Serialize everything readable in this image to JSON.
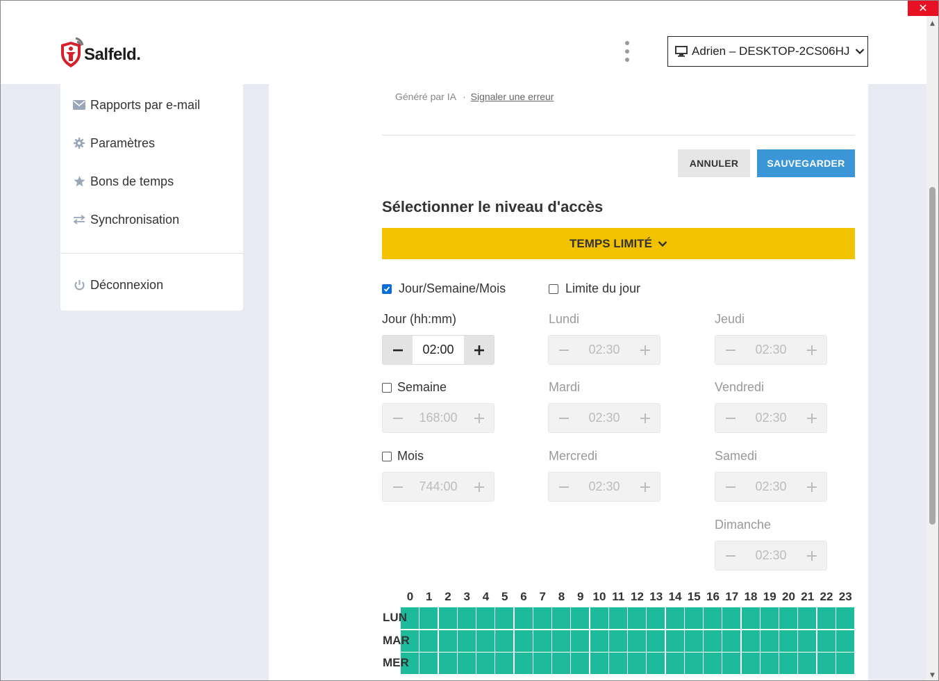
{
  "window": {
    "close_symbol": "✕"
  },
  "header": {
    "logo_text": "Salfeld.",
    "device_label": "Adrien – DESKTOP-2CS06HJ"
  },
  "sidebar": {
    "items": [
      {
        "label": "Rapports par e-mail",
        "icon": "envelope-icon"
      },
      {
        "label": "Paramètres",
        "icon": "gear-icon"
      },
      {
        "label": "Bons de temps",
        "icon": "star-icon"
      },
      {
        "label": "Synchronisation",
        "icon": "sync-arrows-icon"
      }
    ],
    "logout_label": "Déconnexion"
  },
  "ai_note": {
    "generated": "Généré par IA",
    "separator": "·",
    "report_link": "Signaler une erreur"
  },
  "actions": {
    "cancel": "ANNULER",
    "save": "SAUVEGARDER"
  },
  "access": {
    "title": "Sélectionner le niveau d'accès",
    "level": "TEMPS LIMITÉ"
  },
  "limits": {
    "period_checkbox": {
      "label": "Jour/Semaine/Mois",
      "checked": true
    },
    "daily_checkbox": {
      "label": "Limite du jour",
      "checked": false
    },
    "day_label": "Jour (hh:mm)",
    "day_value": "02:00",
    "week_label": "Semaine",
    "week_checked": false,
    "week_value": "168:00",
    "month_label": "Mois",
    "month_checked": false,
    "month_value": "744:00",
    "weekdays": [
      {
        "label": "Lundi",
        "value": "02:30"
      },
      {
        "label": "Mardi",
        "value": "02:30"
      },
      {
        "label": "Mercredi",
        "value": "02:30"
      },
      {
        "label": "Jeudi",
        "value": "02:30"
      },
      {
        "label": "Vendredi",
        "value": "02:30"
      },
      {
        "label": "Samedi",
        "value": "02:30"
      },
      {
        "label": "Dimanche",
        "value": "02:30"
      }
    ]
  },
  "schedule": {
    "hours": [
      "0",
      "1",
      "2",
      "3",
      "4",
      "5",
      "6",
      "7",
      "8",
      "9",
      "10",
      "11",
      "12",
      "13",
      "14",
      "15",
      "16",
      "17",
      "18",
      "19",
      "20",
      "21",
      "22",
      "23"
    ],
    "days": [
      "LUN",
      "MAR",
      "MER"
    ],
    "cell_color": "#1dbb9b"
  },
  "colors": {
    "accent_blue": "#3b96d8",
    "access_yellow": "#f2c200",
    "allowed_green": "#1dbb9b"
  }
}
